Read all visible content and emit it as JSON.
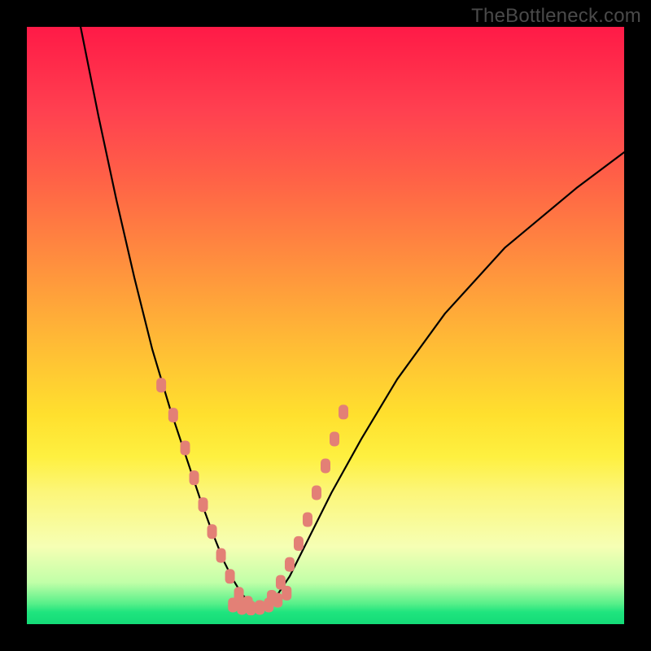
{
  "watermark": "TheBottleneck.com",
  "chart_data": {
    "type": "line",
    "title": "",
    "xlabel": "",
    "ylabel": "",
    "xlim": [
      0,
      100
    ],
    "ylim": [
      0,
      100
    ],
    "series": [
      {
        "name": "bottleneck-curve",
        "color": "#000000",
        "x": [
          9,
          12,
          15,
          18,
          21,
          24,
          27,
          29,
          31,
          33,
          34.5,
          36,
          37.5,
          39,
          40.5,
          42,
          44,
          47,
          51,
          56,
          62,
          70,
          80,
          92,
          100
        ],
        "y": [
          100,
          85,
          71,
          58,
          46,
          36,
          27,
          21,
          15.5,
          10.5,
          7.5,
          5,
          3.5,
          2.8,
          3.5,
          5,
          8,
          14,
          22,
          31,
          41,
          52,
          63,
          73,
          79
        ]
      },
      {
        "name": "highlight-band-left",
        "color": "#e38076",
        "x": [
          22.5,
          24.5,
          26.5,
          28,
          29.5,
          31,
          32.5,
          34,
          35.5,
          37
        ],
        "y": [
          40,
          35,
          29.5,
          24.5,
          20,
          15.5,
          11.5,
          8,
          5,
          3.5
        ]
      },
      {
        "name": "highlight-band-right",
        "color": "#e38076",
        "x": [
          41,
          42.5,
          44,
          45.5,
          47,
          48.5,
          50,
          51.5,
          53
        ],
        "y": [
          4.5,
          7,
          10,
          13.5,
          17.5,
          22,
          26.5,
          31,
          35.5
        ]
      },
      {
        "name": "highlight-band-bottom",
        "color": "#e38076",
        "x": [
          34.5,
          36,
          37.5,
          39,
          40.5,
          42,
          43.5
        ],
        "y": [
          3.2,
          2.8,
          2.7,
          2.8,
          3.2,
          4,
          5.2
        ]
      }
    ]
  }
}
